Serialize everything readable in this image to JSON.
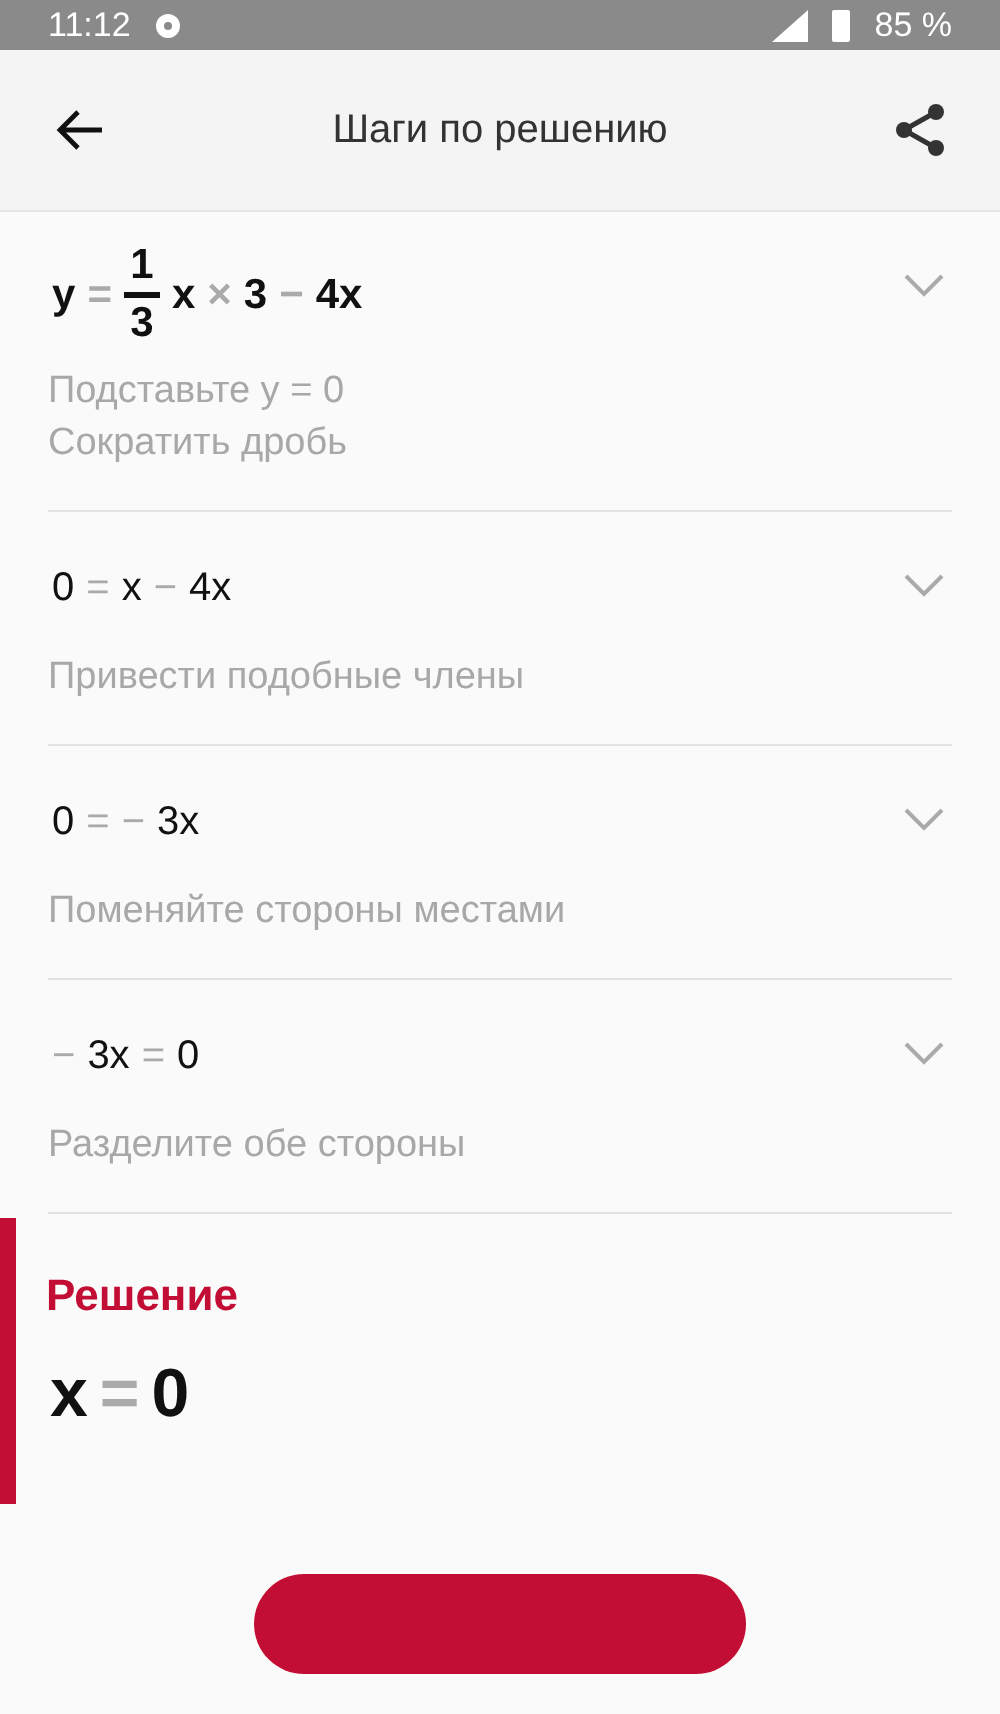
{
  "status_bar": {
    "time": "11:12",
    "battery": "85 %"
  },
  "header": {
    "title": "Шаги по решению"
  },
  "steps": [
    {
      "bold": true,
      "expanded": false,
      "equation": [
        {
          "kind": "term",
          "text": "y"
        },
        {
          "kind": "op",
          "text": "="
        },
        {
          "kind": "frac",
          "num": "1",
          "den": "3"
        },
        {
          "kind": "term",
          "text": "x"
        },
        {
          "kind": "op",
          "text": "×"
        },
        {
          "kind": "term",
          "text": "3"
        },
        {
          "kind": "op",
          "text": "−"
        },
        {
          "kind": "term",
          "text": "4x"
        }
      ],
      "notes": [
        "Подставьте y = 0",
        "Сократить дробь"
      ]
    },
    {
      "bold": false,
      "expanded": false,
      "equation": [
        {
          "kind": "term",
          "text": "0"
        },
        {
          "kind": "op",
          "text": "="
        },
        {
          "kind": "term",
          "text": "x"
        },
        {
          "kind": "op",
          "text": "−"
        },
        {
          "kind": "term",
          "text": "4x"
        }
      ],
      "notes": [
        "Привести подобные члены"
      ]
    },
    {
      "bold": false,
      "expanded": false,
      "equation": [
        {
          "kind": "term",
          "text": "0"
        },
        {
          "kind": "op",
          "text": "="
        },
        {
          "kind": "op",
          "text": "−"
        },
        {
          "kind": "term",
          "text": "3x"
        }
      ],
      "notes": [
        "Поменяйте стороны местами"
      ]
    },
    {
      "bold": false,
      "expanded": false,
      "equation": [
        {
          "kind": "op",
          "text": "−"
        },
        {
          "kind": "term",
          "text": "3x"
        },
        {
          "kind": "op",
          "text": "="
        },
        {
          "kind": "term",
          "text": "0"
        }
      ],
      "notes": [
        "Разделите обе стороны"
      ]
    }
  ],
  "solution": {
    "title": "Решение",
    "equation": [
      {
        "kind": "term",
        "text": "x"
      },
      {
        "kind": "op",
        "text": "="
      },
      {
        "kind": "term",
        "text": "0"
      }
    ]
  }
}
